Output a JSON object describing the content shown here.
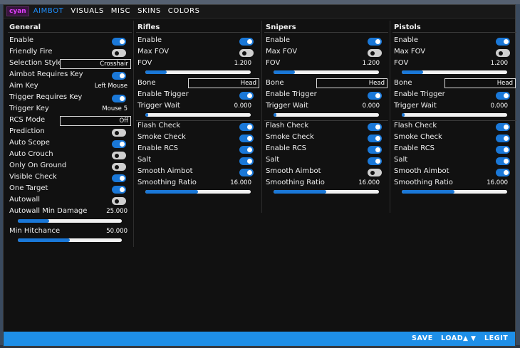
{
  "brand": "cyan",
  "tabs": [
    "AIMBOT",
    "VISUALS",
    "MISC",
    "SKINS",
    "COLORS"
  ],
  "general": {
    "title": "General",
    "enable": "Enable",
    "friendly_fire": "Friendly Fire",
    "selection_style": "Selection Style",
    "selection_style_value": "Crosshair",
    "aimbot_requires_key": "Aimbot Requires Key",
    "aim_key": "Aim Key",
    "aim_key_value": "Left Mouse",
    "trigger_requires_key": "Trigger Requires Key",
    "trigger_key": "Trigger Key",
    "trigger_key_value": "Mouse 5",
    "rcs_mode": "RCS Mode",
    "rcs_mode_value": "Off",
    "prediction": "Prediction",
    "auto_scope": "Auto Scope",
    "auto_crouch": "Auto Crouch",
    "only_on_ground": "Only On Ground",
    "visible_check": "Visible Check",
    "one_target": "One Target",
    "autowall": "Autowall",
    "autowall_min_damage": "Autowall Min Damage",
    "autowall_min_damage_value": "25.000",
    "min_hitchance": "Min Hitchance",
    "min_hitchance_value": "50.000",
    "levels": {
      "autowall_min_damage": 0.3,
      "min_hitchance": 0.5
    }
  },
  "weapons": [
    {
      "title": "Rifles",
      "enable": "Enable",
      "max_fov": "Max FOV",
      "fov": "FOV",
      "fov_value": "1.200",
      "bone": "Bone",
      "bone_value": "Head",
      "enable_trigger": "Enable Trigger",
      "trigger_wait": "Trigger Wait",
      "trigger_wait_value": "0.000",
      "flash_check": "Flash Check",
      "smoke_check": "Smoke Check",
      "enable_rcs": "Enable RCS",
      "salt": "Salt",
      "smooth_aimbot": "Smooth Aimbot",
      "smoothing_ratio": "Smoothing Ratio",
      "smoothing_ratio_value": "16.000"
    },
    {
      "title": "Snipers",
      "enable": "Enable",
      "max_fov": "Max FOV",
      "fov": "FOV",
      "fov_value": "1.200",
      "bone": "Bone",
      "bone_value": "Head",
      "enable_trigger": "Enable Trigger",
      "trigger_wait": "Trigger Wait",
      "trigger_wait_value": "0.000",
      "flash_check": "Flash Check",
      "smoke_check": "Smoke Check",
      "enable_rcs": "Enable RCS",
      "salt": "Salt",
      "smooth_aimbot": "Smooth Aimbot",
      "smoothing_ratio": "Smoothing Ratio",
      "smoothing_ratio_value": "16.000"
    },
    {
      "title": "Pistols",
      "enable": "Enable",
      "max_fov": "Max FOV",
      "fov": "FOV",
      "fov_value": "1.200",
      "bone": "Bone",
      "bone_value": "Head",
      "enable_trigger": "Enable Trigger",
      "trigger_wait": "Trigger Wait",
      "trigger_wait_value": "0.000",
      "flash_check": "Flash Check",
      "smoke_check": "Smoke Check",
      "enable_rcs": "Enable RCS",
      "salt": "Salt",
      "smooth_aimbot": "Smooth Aimbot",
      "smoothing_ratio": "Smoothing Ratio",
      "smoothing_ratio_value": "16.000"
    }
  ],
  "weapon_toggles": [
    {
      "enable": true,
      "max_fov": false,
      "enable_trigger": true,
      "flash_check": true,
      "smoke_check": true,
      "enable_rcs": true,
      "salt": true,
      "smooth_aimbot": true
    },
    {
      "enable": true,
      "max_fov": false,
      "enable_trigger": true,
      "flash_check": true,
      "smoke_check": true,
      "enable_rcs": true,
      "salt": true,
      "smooth_aimbot": false
    },
    {
      "enable": true,
      "max_fov": false,
      "enable_trigger": true,
      "flash_check": true,
      "smoke_check": true,
      "enable_rcs": true,
      "salt": true,
      "smooth_aimbot": true
    }
  ],
  "weapon_levels": {
    "fov": 0.2,
    "trigger_wait": 0.02,
    "smoothing_ratio": 0.5
  },
  "general_toggles": {
    "enable": true,
    "friendly_fire": false,
    "aimbot_requires_key": true,
    "trigger_requires_key": true,
    "prediction": false,
    "auto_scope": true,
    "auto_crouch": false,
    "only_on_ground": false,
    "visible_check": true,
    "one_target": true,
    "autowall": false
  },
  "footer": {
    "save": "SAVE",
    "load": "LOAD",
    "legit": "LEGIT"
  },
  "colors": {
    "accent": "#1a78d8",
    "footer": "#1e8fe8",
    "brand": "#e040fb"
  }
}
